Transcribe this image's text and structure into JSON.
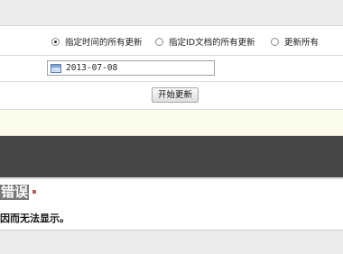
{
  "options": {
    "by_time": "指定时间的所有更新",
    "by_id": "指定ID文档的所有更新",
    "all": "更新所有",
    "selected": "by_time"
  },
  "date": {
    "value": "2013-07-08"
  },
  "start_button": "开始更新",
  "error": {
    "title": "错误",
    "message": "因而无法显示。"
  }
}
